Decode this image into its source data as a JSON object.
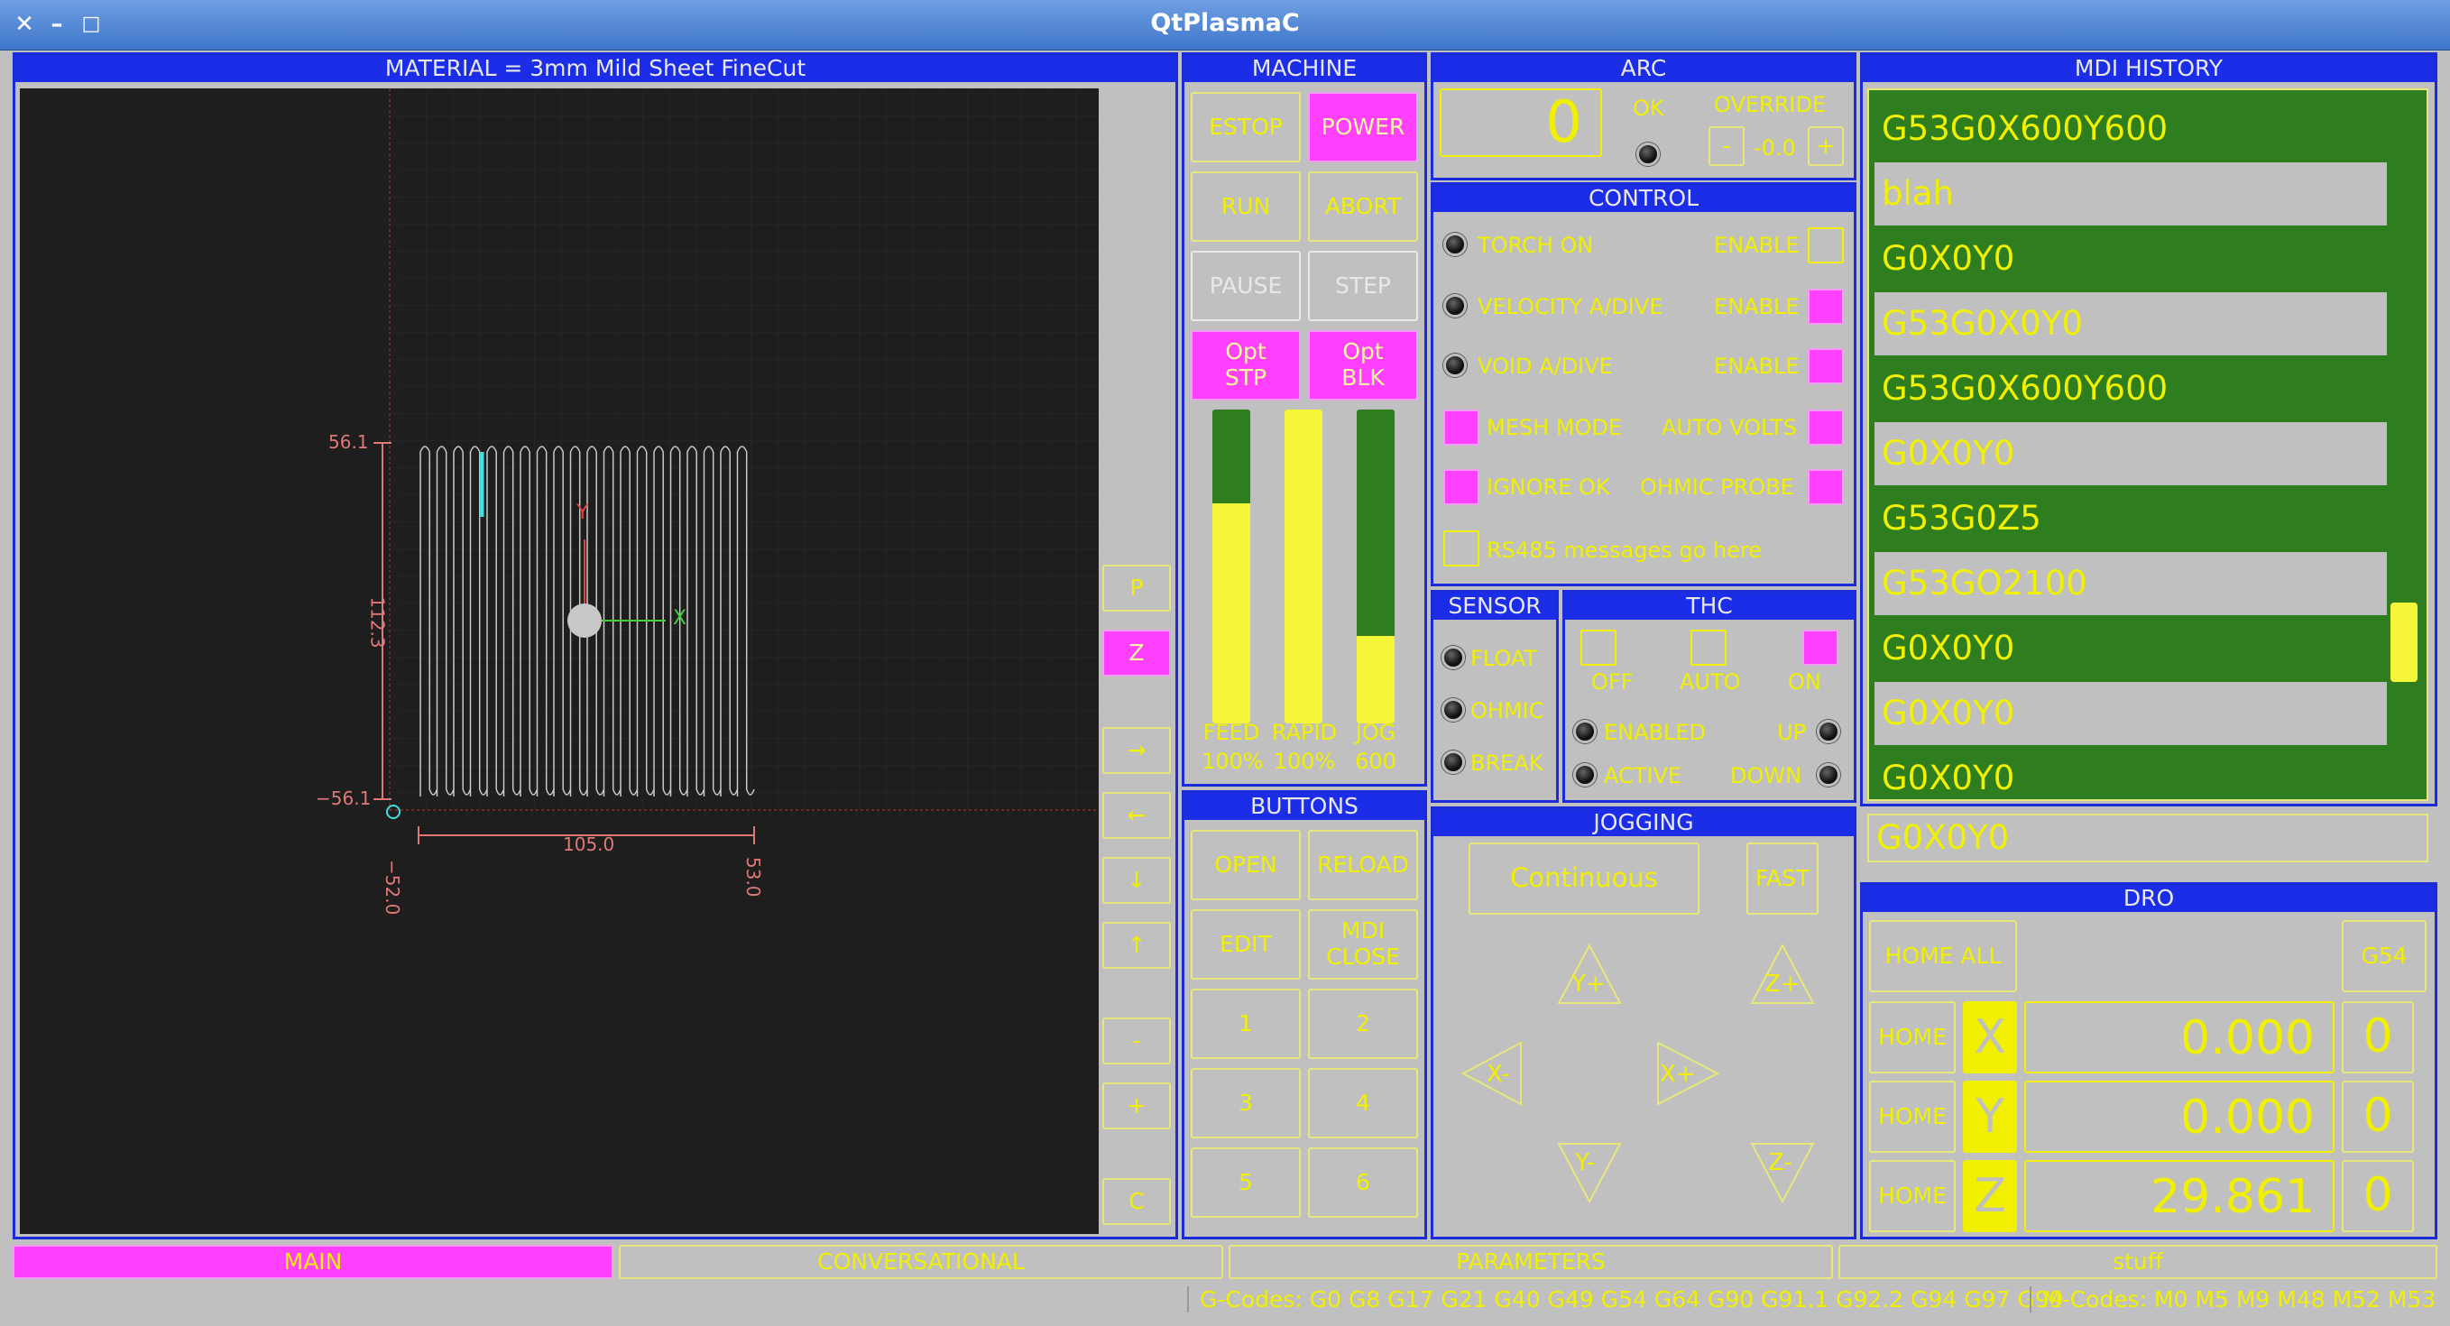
{
  "window": {
    "title": "QtPlasmaC",
    "close": "✕",
    "minimize": "–",
    "maximize": "□"
  },
  "preview": {
    "header": "MATERIAL = 3mm Mild Sheet FineCut",
    "dim_top": "56.1",
    "dim_bottom": "−56.1",
    "dim_height": "112.3",
    "dim_width": "105.0",
    "dim_left": "−52.0",
    "dim_right": "53.0",
    "axis_y": "Y",
    "axis_x": "X"
  },
  "view_buttons": [
    "P",
    "Z",
    "→",
    "←",
    "↓",
    "↑",
    "-",
    "+",
    "C"
  ],
  "machine": {
    "header": "MACHINE",
    "estop": "ESTOP",
    "power": "POWER",
    "run": "RUN",
    "abort": "ABORT",
    "pause": "PAUSE",
    "step": "STEP",
    "optstp": "Opt\nSTP",
    "optblk": "Opt\nBLK",
    "feed_label": "FEED",
    "feed_value": "100%",
    "rapid_label": "RAPID",
    "rapid_value": "100%",
    "jog_label": "JOG",
    "jog_value": "600",
    "feed_level": 0.7,
    "rapid_level": 1.0,
    "jog_level": 0.28
  },
  "buttons": {
    "header": "BUTTONS",
    "open": "OPEN",
    "reload": "RELOAD",
    "edit": "EDIT",
    "mdiclose": "MDI\nCLOSE",
    "b1": "1",
    "b2": "2",
    "b3": "3",
    "b4": "4",
    "b5": "5",
    "b6": "6"
  },
  "arc": {
    "header": "ARC",
    "voltage": "0",
    "ok": "OK",
    "override": "OVERRIDE",
    "minus": "-",
    "value": "-0.0",
    "plus": "+"
  },
  "control": {
    "header": "CONTROL",
    "torch_on": "TORCH ON",
    "velocity": "VELOCITY A/DIVE",
    "void": "VOID A/DIVE",
    "mesh": "MESH MODE",
    "ignore": "IGNORE OK",
    "enable": "ENABLE",
    "auto_volts": "AUTO VOLTS",
    "ohmic_probe": "OHMIC PROBE",
    "rs485": "RS485 messages go here"
  },
  "sensor": {
    "header": "SENSOR",
    "float": "FLOAT",
    "ohmic": "OHMIC",
    "break": "BREAK"
  },
  "thc": {
    "header": "THC",
    "off": "OFF",
    "auto": "AUTO",
    "on": "ON",
    "enabled": "ENABLED",
    "active": "ACTIVE",
    "up": "UP",
    "down": "DOWN"
  },
  "jogging": {
    "header": "JOGGING",
    "mode": "Continuous",
    "fast": "FAST",
    "yplus": "Y+",
    "yminus": "Y-",
    "xplus": "X+",
    "xminus": "X-",
    "zplus": "Z+",
    "zminus": "Z-"
  },
  "mdi": {
    "header": "MDI HISTORY",
    "items": [
      "G53G0X600Y600",
      "blah",
      "G0X0Y0",
      "G53G0X0Y0",
      "G53G0X600Y600",
      "G0X0Y0",
      "G53G0Z5",
      "G53GO2100",
      "G0X0Y0",
      "G0X0Y0",
      "G0X0Y0"
    ],
    "input": "G0X0Y0"
  },
  "dro": {
    "header": "DRO",
    "home_all": "HOME ALL",
    "g54": "G54",
    "home": "HOME",
    "x": "X",
    "y": "Y",
    "z": "Z",
    "x_val": "0.000",
    "y_val": "0.000",
    "z_val": "29.861",
    "zero": "0"
  },
  "tabs": [
    "MAIN",
    "CONVERSATIONAL",
    "PARAMETERS",
    "stuff"
  ],
  "status": {
    "gcodes": "G-Codes: G0 G8 G17 G21 G40 G49 G54 G64 G90 G91.1 G92.2 G94 G97 G99",
    "mcodes": "M-Codes: M0 M5 M9 M48 M52 M53"
  }
}
